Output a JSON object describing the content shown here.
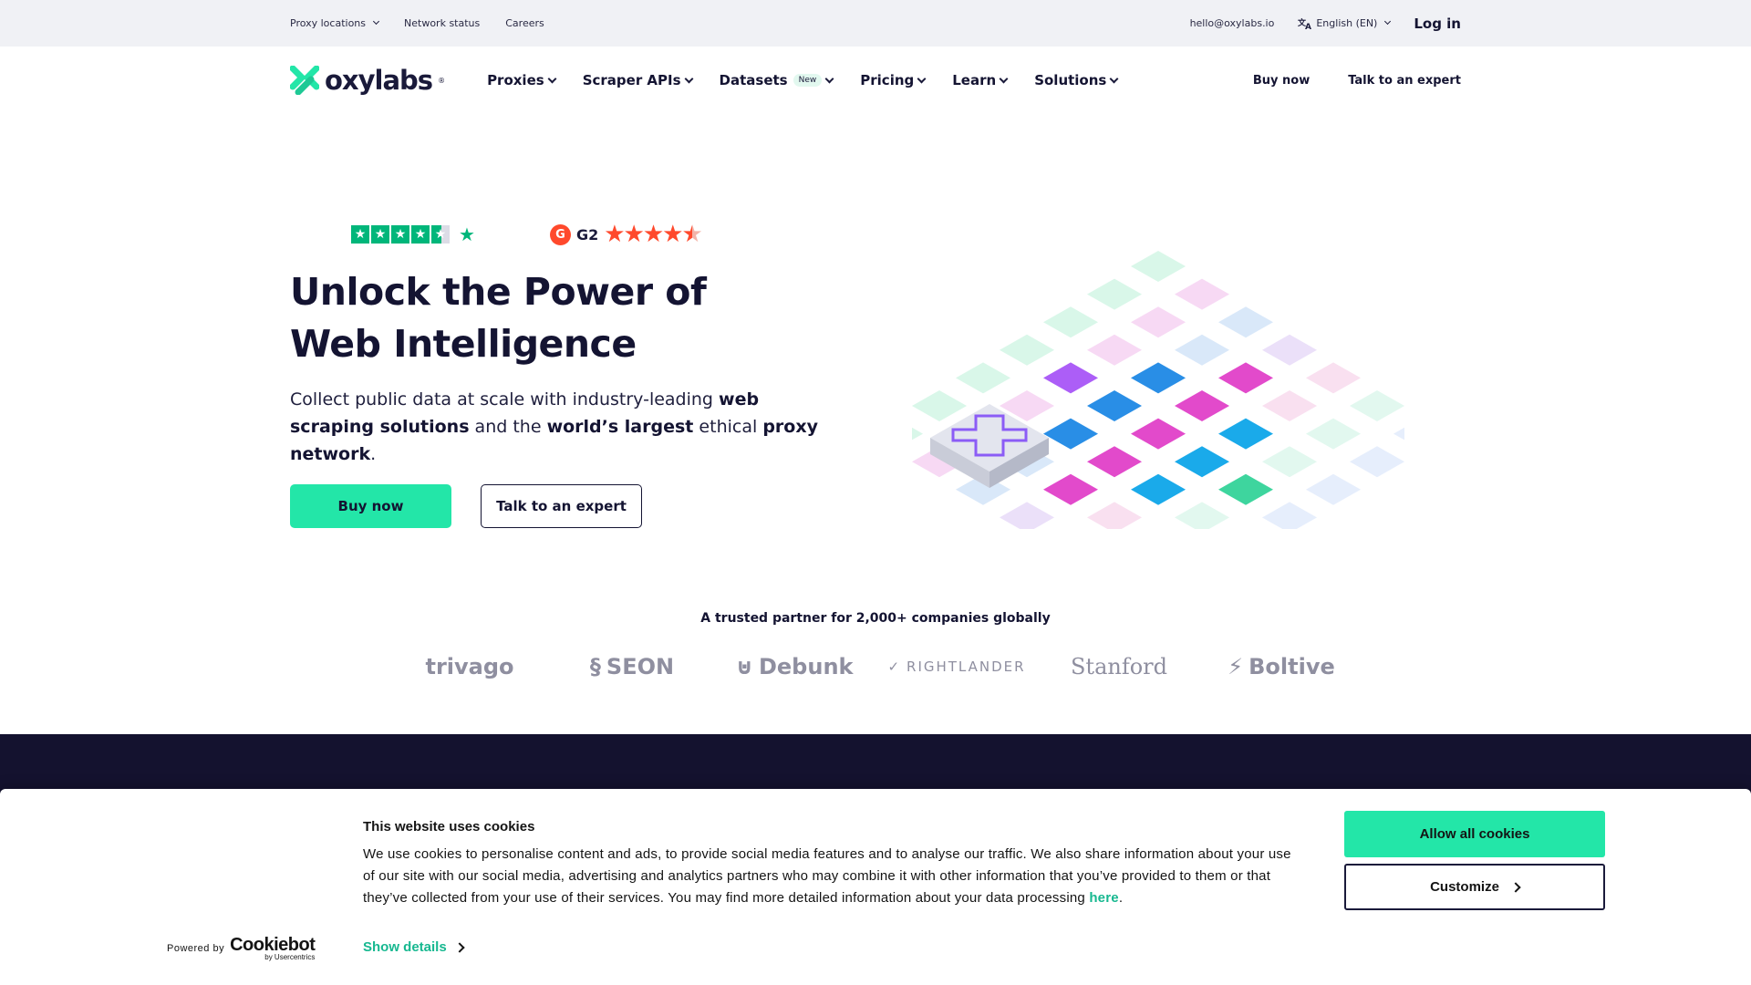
{
  "topbar": {
    "proxy_locations": "Proxy locations",
    "network_status": "Network status",
    "careers": "Careers",
    "email": "hello@oxylabs.io",
    "language": "English (EN)",
    "login": "Log in"
  },
  "nav": {
    "logo": "oxylabs",
    "items": [
      {
        "label": "Proxies"
      },
      {
        "label": "Scraper APIs"
      },
      {
        "label": "Datasets",
        "badge": "New"
      },
      {
        "label": "Pricing"
      },
      {
        "label": "Learn"
      },
      {
        "label": "Solutions"
      }
    ],
    "buy_now": "Buy now",
    "talk_expert": "Talk to an expert"
  },
  "ratings": {
    "g2_label": "G2",
    "trustpilot_stars": 4.5,
    "g2_stars": 4.5
  },
  "hero": {
    "title": "Unlock the Power of Web Intelligence",
    "sub_1": "Collect public data at scale with industry-leading ",
    "sub_b1": "web scraping solutions",
    "sub_2": " and the ",
    "sub_b2": "world’s largest",
    "sub_3": " ethical ",
    "sub_b3": "proxy network",
    "sub_4": ".",
    "buy_now": "Buy now",
    "talk_expert": "Talk to an expert"
  },
  "trusted": {
    "heading": "A trusted partner for 2,000+ companies globally",
    "logos": [
      "trivago",
      "SEON",
      "Debunk",
      "RIGHTLANDER",
      "Stanford",
      "Boltive"
    ]
  },
  "cookie": {
    "title": "This website uses cookies",
    "body": "We use cookies to personalise content and ads, to provide social media features and to analyse our traffic. We also share information about your use of our site with our social media, advertising and analytics partners who may combine it with other information that you’ve provided to them or that they’ve collected from your use of their services. You may find more detailed information about your data processing ",
    "here": "here",
    "show_details": "Show details",
    "powered_by": "Powered by",
    "cookiebot": "Cookiebot",
    "cookiebot_sub": "by Usercentrics",
    "allow_all": "Allow all cookies",
    "customize": "Customize"
  },
  "colors": {
    "accent": "#23e6a8",
    "dark": "#14122f",
    "link": "#17b890"
  }
}
